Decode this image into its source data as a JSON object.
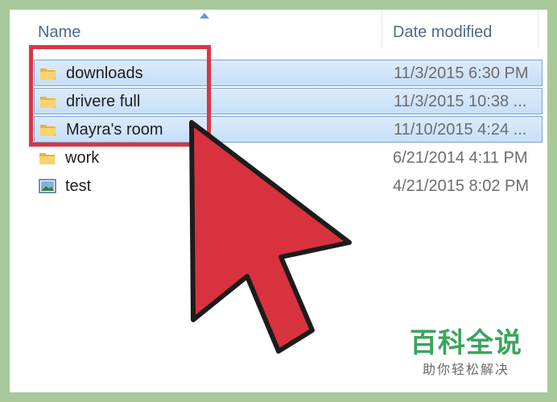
{
  "columns": {
    "name": "Name",
    "date_modified": "Date modified"
  },
  "files": [
    {
      "name": "downloads",
      "date": "11/3/2015 6:30 PM",
      "type": "folder",
      "selected": true,
      "icon": "folder-icon"
    },
    {
      "name": "drivere full",
      "date": "11/3/2015 10:38 ...",
      "type": "folder",
      "selected": true,
      "icon": "folder-icon"
    },
    {
      "name": "Mayra's room",
      "date": "11/10/2015 4:24 ...",
      "type": "folder",
      "selected": true,
      "icon": "folder-icon"
    },
    {
      "name": "work",
      "date": "6/21/2014 4:11 PM",
      "type": "folder",
      "selected": false,
      "icon": "folder-icon"
    },
    {
      "name": "test",
      "date": "4/21/2015 8:02 PM",
      "type": "image",
      "selected": false,
      "icon": "image-file-icon"
    }
  ],
  "watermark": {
    "title": "百科全说",
    "subtitle": "助你轻松解决"
  },
  "colors": {
    "background": "#a9c89a",
    "selection": "#cce4f7",
    "selection_border": "#7da2ce",
    "highlight_red": "#d93644",
    "watermark_green": "#3aa55b"
  }
}
